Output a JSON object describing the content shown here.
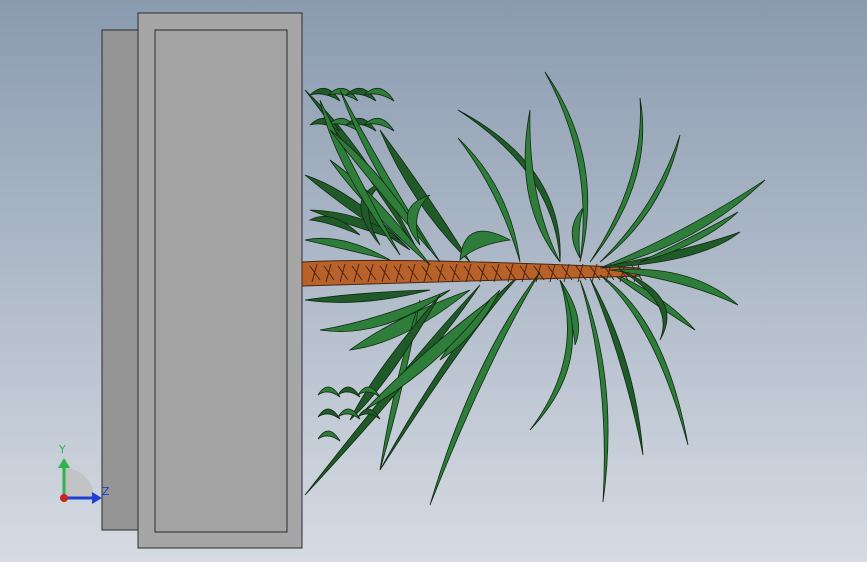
{
  "viewport": {
    "background_top": "#8a9bb0",
    "background_bottom": "#d6dbe3"
  },
  "planter": {
    "back_color": "#959595",
    "front_color": "#a6a6a6",
    "inner_color": "#a3a3a3",
    "edge_color": "#2b2b2b"
  },
  "plant": {
    "leaf_color": "#2f7d3a",
    "leaf_dark": "#1f5a28",
    "leaf_edge": "#0f2a12",
    "trunk_color": "#b8622a",
    "trunk_edge": "#4a2410"
  },
  "triad": {
    "y_label": "Y",
    "z_label": "Z",
    "y_color": "#2db34a",
    "z_color": "#1f3fd0",
    "x_color": "#d02020"
  }
}
